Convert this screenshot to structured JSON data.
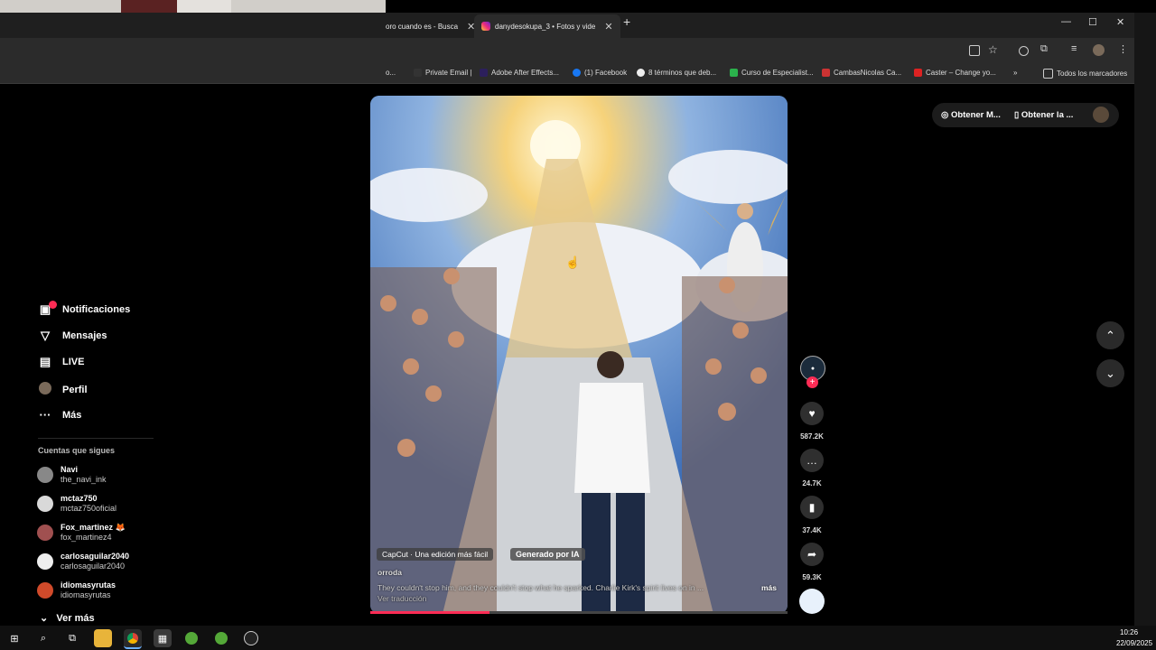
{
  "browser": {
    "tabs": [
      {
        "label": "oro cuando es - Busca"
      },
      {
        "label": "danydesokupa_3 • Fotos y vide"
      }
    ],
    "bookmarks": [
      {
        "label": "o..."
      },
      {
        "label": "Private Email |"
      },
      {
        "label": "Adobe After Effects..."
      },
      {
        "label": "(1) Facebook"
      },
      {
        "label": "8 términos que deb..."
      },
      {
        "label": "Curso de Especialist..."
      },
      {
        "label": "CambasNicolas Ca..."
      },
      {
        "label": "Caster – Change yo..."
      },
      {
        "label": "»"
      },
      {
        "label": "Todos los marcadores"
      }
    ]
  },
  "sidebar": {
    "nav": [
      {
        "label": "Notificaciones",
        "icon": "inbox-icon"
      },
      {
        "label": "Mensajes",
        "icon": "send-icon"
      },
      {
        "label": "LIVE",
        "icon": "live-tv-icon"
      },
      {
        "label": "Perfil",
        "icon": "profile-avatar"
      },
      {
        "label": "Más",
        "icon": "more-dots-icon"
      }
    ],
    "following_title": "Cuentas que sigues",
    "accounts": [
      {
        "name": "Navi",
        "handle": "the_navi_ink",
        "color": "#888888"
      },
      {
        "name": "mctaz750",
        "handle": "mctaz750oficial",
        "color": "#d9d9d9"
      },
      {
        "name": "Fox_martinez 🦊",
        "handle": "fox_martinez4",
        "color": "#a05050"
      },
      {
        "name": "carlosaguilar2040",
        "handle": "carlosaguilar2040",
        "color": "#eeeeee"
      },
      {
        "name": "idiomasyrutas",
        "handle": "idiomasyrutas",
        "color": "#d04a2a"
      }
    ],
    "see_more": "Ver más"
  },
  "video": {
    "capcut_label": "CapCut · Una edición más fácil",
    "ai_label": "Generado por IA",
    "author": "orroda",
    "caption": "They couldn't stop him, and they couldn't stop what he sparked. Charlie Kirk's spirit lives on in ...",
    "more_label": "más",
    "translate_label": "Ver traducción",
    "progress": 0.286
  },
  "actions": {
    "likes": "587.2K",
    "comments": "24.7K",
    "saves": "37.4K",
    "shares": "59.3K"
  },
  "topright": {
    "get_coins": "Obtener M...",
    "get_app": "Obtener la ..."
  },
  "taskbar": {
    "time": "10:26",
    "date": "22/09/2025"
  },
  "colors": {
    "accent": "#fe2c55",
    "background": "#000000"
  }
}
